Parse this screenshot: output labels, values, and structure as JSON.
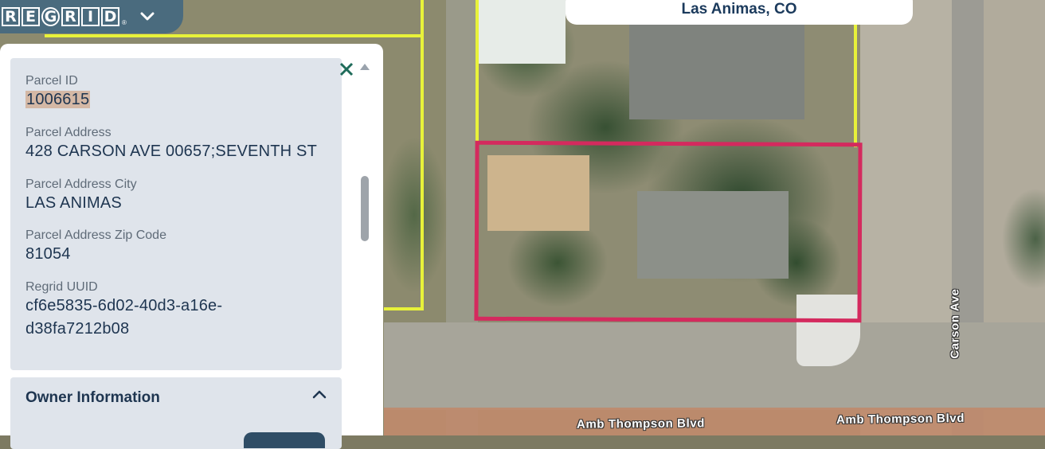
{
  "app": {
    "logo_letters": [
      "R",
      "E",
      "G",
      "R",
      "I",
      "D"
    ],
    "logo_mark": "®",
    "logo_menu_icon": "chevron-down-icon"
  },
  "location": {
    "place": "Las Animas, CO"
  },
  "parcel": {
    "fields": [
      {
        "label": "Parcel ID",
        "value": "1006615"
      },
      {
        "label": "Parcel Address",
        "value": "428 CARSON AVE 00657;SEVENTH ST"
      },
      {
        "label": "Parcel Address City",
        "value": "LAS ANIMAS"
      },
      {
        "label": "Parcel Address Zip Code",
        "value": "81054"
      },
      {
        "label": "Regrid UUID",
        "value_line1": "cf6e5835-6d02-40d3-a16e-",
        "value_line2": "d38fa7212b08"
      }
    ]
  },
  "owner": {
    "title": "Owner Information"
  },
  "map_labels": {
    "street_bottom_1": "Amb Thompson Blvd",
    "street_bottom_2": "Amb Thompson Blvd",
    "street_right": "Carson Ave"
  },
  "colors": {
    "selected_parcel": "#d42a5e",
    "parcel_lines": "#e8f23a",
    "panel_bg": "#dfe4eb",
    "text_dark": "#1e3550",
    "close_icon": "#1e6b5a"
  }
}
